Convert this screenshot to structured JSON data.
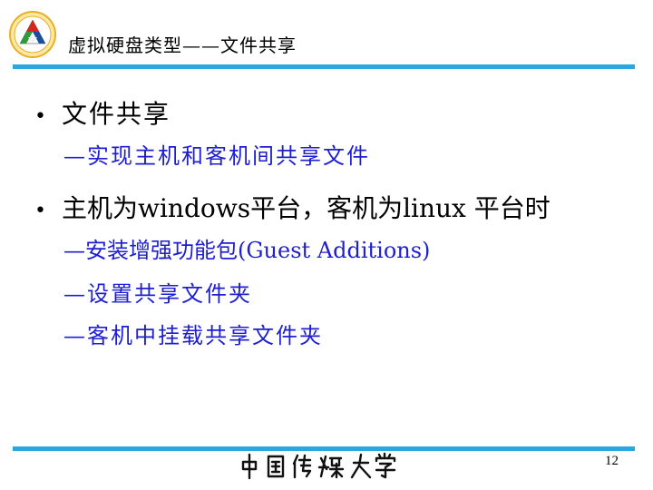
{
  "header": {
    "title": "虚拟硬盘类型——文件共享"
  },
  "bullets": [
    {
      "text": "文件共享",
      "subs": [
        "—实现主机和客机间共享文件"
      ]
    },
    {
      "text": "主机为windows平台，客机为linux 平台时",
      "subs": [
        "—安装增强功能包(Guest Additions)",
        "—设置共享文件夹",
        "—客机中挂载共享文件夹"
      ]
    }
  ],
  "footer": {
    "university_name": "中国传媒大学",
    "page_number": "12"
  },
  "colors": {
    "accent_rule": "#29a8e0",
    "sub_text": "#1e1ed2",
    "logo_red": "#d4281f",
    "logo_green": "#2e9b3a",
    "logo_blue": "#1a4fa0",
    "logo_gold": "#e8b023"
  },
  "icons": {
    "logo": "university-emblem-icon",
    "bullet": "bullet-dot-icon"
  }
}
